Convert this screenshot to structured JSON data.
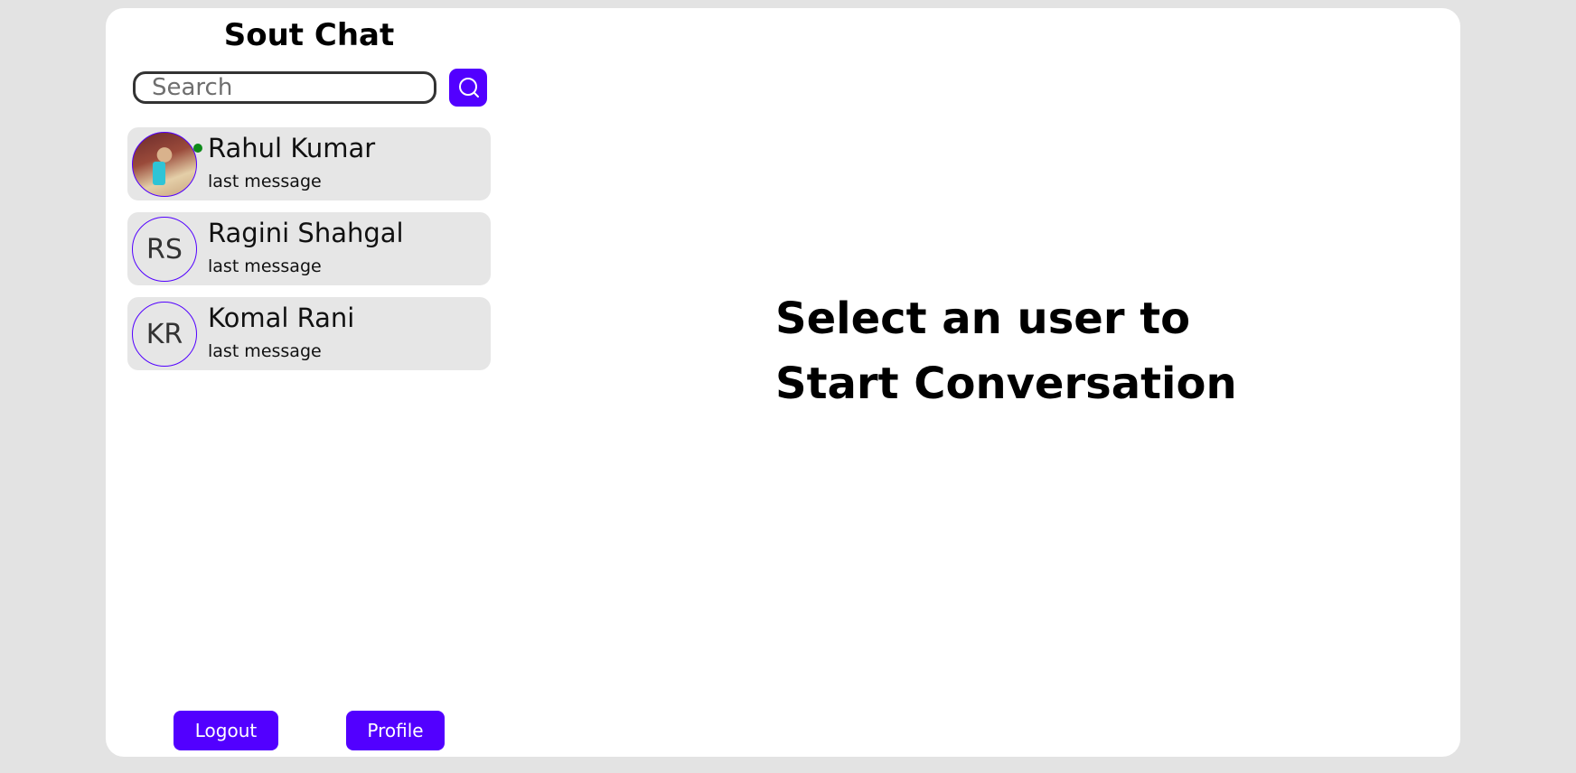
{
  "app": {
    "title": "Sout Chat"
  },
  "search": {
    "placeholder": "Search",
    "value": ""
  },
  "colors": {
    "accent": "#5200ff",
    "online": "#0e8a1a",
    "card": "#e6e6e6",
    "background": "#e3e3e3"
  },
  "users": [
    {
      "name": "Rahul Kumar",
      "last_message": "last message",
      "initials": "",
      "online": true,
      "avatar": "photo"
    },
    {
      "name": "Ragini Shahgal",
      "last_message": "last message",
      "initials": "RS",
      "online": false,
      "avatar": "initials"
    },
    {
      "name": "Komal Rani",
      "last_message": "last message",
      "initials": "KR",
      "online": false,
      "avatar": "initials"
    }
  ],
  "buttons": {
    "logout_label": "Logout",
    "profile_label": "Profile"
  },
  "main": {
    "empty_line1": "Select an user to",
    "empty_line2": "Start Conversation"
  }
}
